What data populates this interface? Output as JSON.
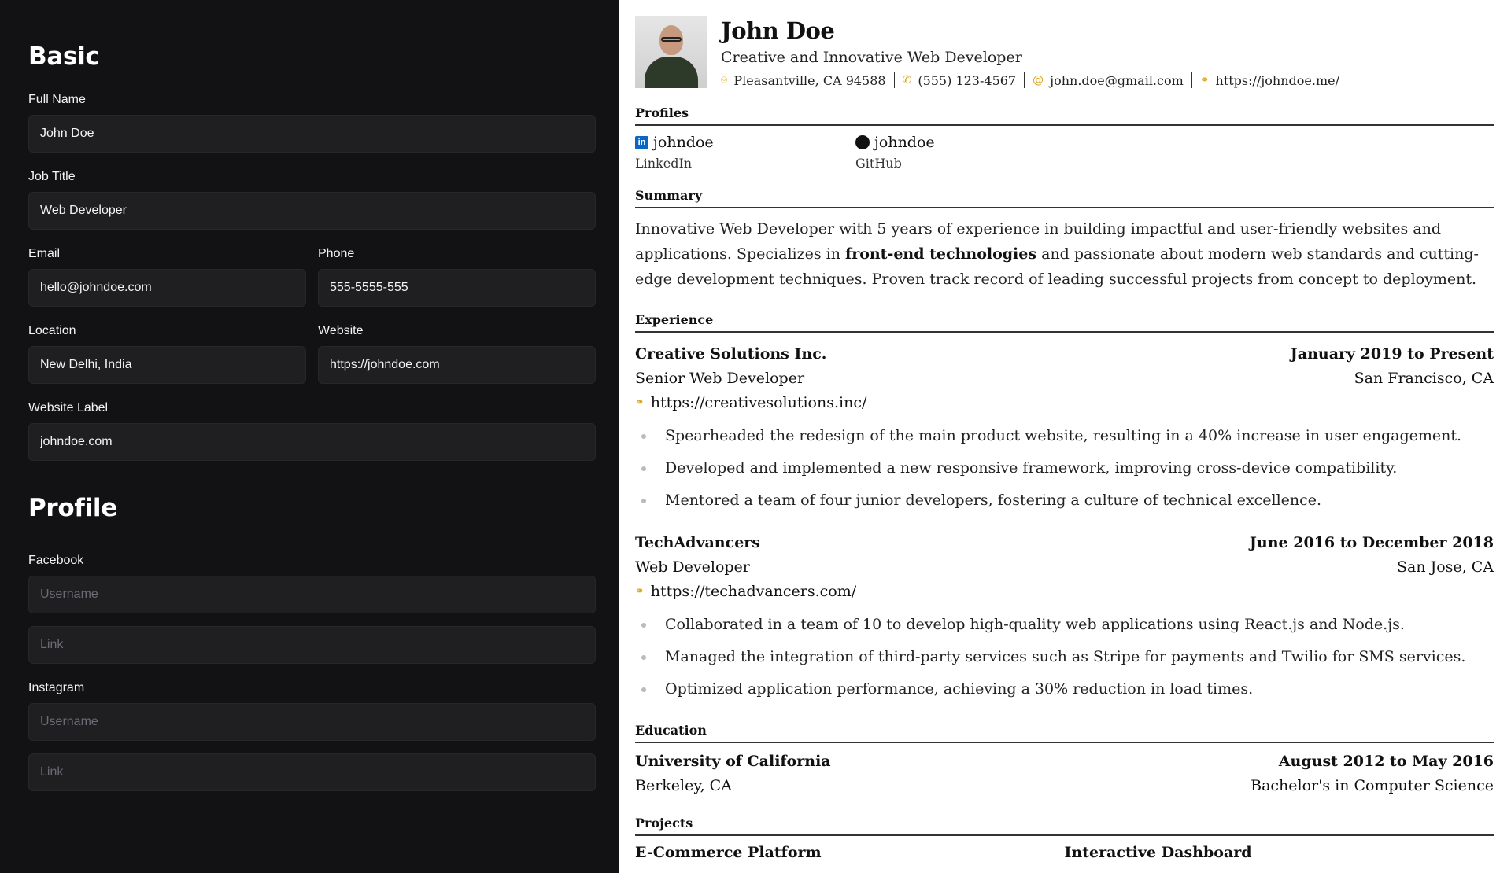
{
  "editor": {
    "basic_title": "Basic",
    "fields": {
      "full_name": {
        "label": "Full Name",
        "value": "John Doe"
      },
      "job_title": {
        "label": "Job Title",
        "value": "Web Developer"
      },
      "email": {
        "label": "Email",
        "value": "hello@johndoe.com"
      },
      "phone": {
        "label": "Phone",
        "value": "555-5555-555"
      },
      "location": {
        "label": "Location",
        "value": "New Delhi, India"
      },
      "website": {
        "label": "Website",
        "value": "https://johndoe.com"
      },
      "website_label": {
        "label": "Website Label",
        "value": "johndoe.com"
      }
    },
    "profile_title": "Profile",
    "profiles": {
      "facebook": {
        "label": "Facebook",
        "username_placeholder": "Username",
        "link_placeholder": "Link"
      },
      "instagram": {
        "label": "Instagram",
        "username_placeholder": "Username",
        "link_placeholder": "Link"
      }
    }
  },
  "resume": {
    "name": "John Doe",
    "headline": "Creative and Innovative Web Developer",
    "location": "Pleasantville, CA 94588",
    "phone": "(555) 123-4567",
    "email": "john.doe@gmail.com",
    "website": "https://johndoe.me/",
    "profiles_heading": "Profiles",
    "profiles": [
      {
        "username": "johndoe",
        "network": "LinkedIn"
      },
      {
        "username": "johndoe",
        "network": "GitHub"
      }
    ],
    "summary_heading": "Summary",
    "summary": {
      "part1": "Innovative Web Developer with 5 years of experience in building impactful and user-friendly websites and applications. Specializes in ",
      "bold": "front-end technologies",
      "part2": " and passionate about modern web standards and cutting-edge development techniques. Proven track record of leading successful projects from concept to deployment."
    },
    "experience_heading": "Experience",
    "experience": [
      {
        "company": "Creative Solutions Inc.",
        "date": "January 2019 to Present",
        "position": "Senior Web Developer",
        "location": "San Francisco, CA",
        "url": "https://creativesolutions.inc/",
        "bullets": [
          "Spearheaded the redesign of the main product website, resulting in a 40% increase in user engagement.",
          "Developed and implemented a new responsive framework, improving cross-device compatibility.",
          "Mentored a team of four junior developers, fostering a culture of technical excellence."
        ]
      },
      {
        "company": "TechAdvancers",
        "date": "June 2016 to December 2018",
        "position": "Web Developer",
        "location": "San Jose, CA",
        "url": "https://techadvancers.com/",
        "bullets": [
          "Collaborated in a team of 10 to develop high-quality web applications using React.js and Node.js.",
          "Managed the integration of third-party services such as Stripe for payments and Twilio for SMS services.",
          "Optimized application performance, achieving a 30% reduction in load times."
        ]
      }
    ],
    "education_heading": "Education",
    "education": {
      "institution": "University of California",
      "date": "August 2012 to May 2016",
      "location": "Berkeley, CA",
      "degree": "Bachelor's in Computer Science"
    },
    "projects_heading": "Projects",
    "projects": [
      "E-Commerce Platform",
      "Interactive Dashboard"
    ]
  }
}
